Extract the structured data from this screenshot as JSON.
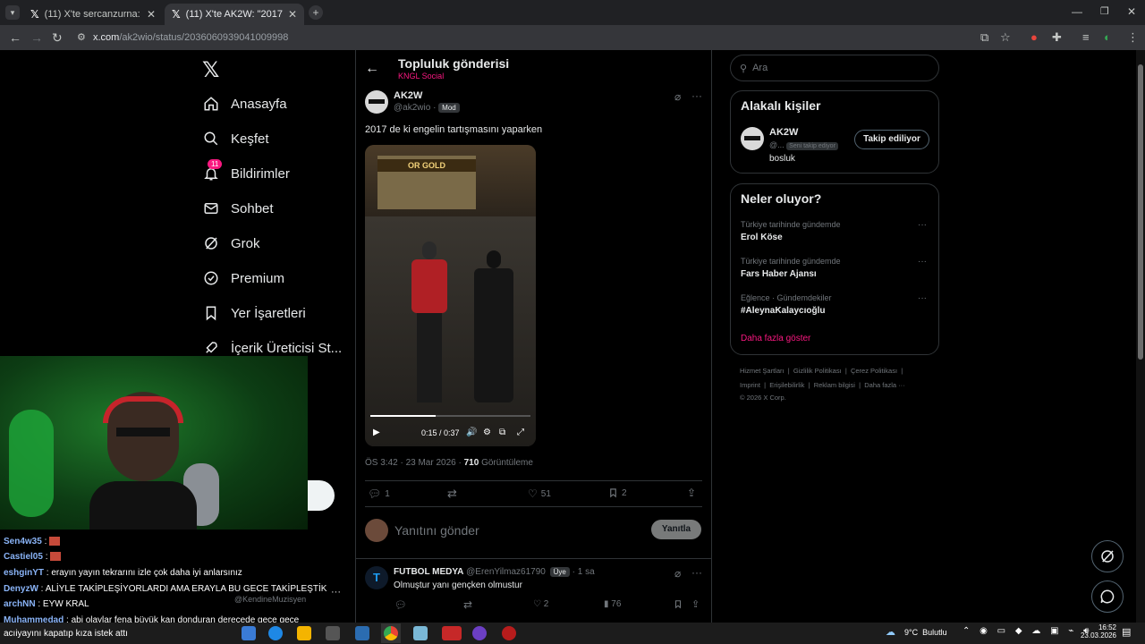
{
  "browser": {
    "tabs": [
      {
        "label": "(11) X'te sercanzurna: \"BEYLER L",
        "active": false
      },
      {
        "label": "(11) X'te AK2W: \"2017 de ki engel",
        "active": true
      }
    ],
    "url_host": "x.com",
    "url_path": "/ak2wio/status/2036060939041009998"
  },
  "nav": {
    "items": [
      {
        "label": "Anasayfa",
        "icon": "home-icon"
      },
      {
        "label": "Keşfet",
        "icon": "search-icon"
      },
      {
        "label": "Bildirimler",
        "icon": "bell-icon",
        "badge": "11"
      },
      {
        "label": "Sohbet",
        "icon": "mail-icon"
      },
      {
        "label": "Grok",
        "icon": "grok-icon"
      },
      {
        "label": "Premium",
        "icon": "verified-icon"
      },
      {
        "label": "Yer İşaretleri",
        "icon": "bookmark-icon"
      },
      {
        "label": "İçerik Üreticisi St...",
        "icon": "rocket-icon"
      }
    ]
  },
  "header": {
    "title": "Topluluk gönderisi",
    "subtitle": "KNGL Social"
  },
  "post": {
    "author_name": "AK2W",
    "handle": "@ak2wio",
    "role_badge": "Mod",
    "text": "2017 de ki engelin tartışmasını yaparken",
    "video_sign": "OR GOLD",
    "video_time": "0:15 / 0:37",
    "video_progress": 0.41,
    "timestamp": "ÖS 3:42 · 23 Mar 2026 · ",
    "views_count": "710",
    "views_label": " Görüntüleme",
    "replies": "1",
    "likes": "51",
    "bookmarks": "2"
  },
  "reply_box": {
    "placeholder": "Yanıtını gönder",
    "button": "Yanıtla"
  },
  "reply": {
    "name": "FUTBOL MEDYA",
    "handle": "@ErenYilmaz61790",
    "badge": "Üye",
    "time": "· 1 sa",
    "text": "Olmuştur yanı gençken olmustur",
    "likes": "2",
    "views": "76"
  },
  "search": {
    "placeholder": "Ara"
  },
  "related": {
    "title": "Alakalı kişiler",
    "name": "AK2W",
    "handle": "@...",
    "follows_you": "Seni takip ediyor",
    "follow_button": "Takip ediliyor",
    "bio": "bosluk"
  },
  "trends": {
    "title": "Neler oluyor?",
    "items": [
      {
        "category": "Türkiye tarihinde gündemde",
        "title": "Erol Köse"
      },
      {
        "category": "Türkiye tarihinde gündemde",
        "title": "Fars Haber Ajansı"
      },
      {
        "category": "Eğlence · Gündemdekiler",
        "title": "#AleynaKalaycıoğlu"
      }
    ],
    "more": "Daha fazla göster"
  },
  "footer": {
    "row1": [
      "Hizmet Şartları",
      "Gizlilik Politikası",
      "Çerez Politikası"
    ],
    "row2": [
      "Imprint",
      "Erişilebilirlik",
      "Reklam bilgisi",
      "Daha fazla ···"
    ],
    "copyright": "© 2026 X Corp."
  },
  "chat": [
    {
      "user": "Sen4w35",
      "msg": " : "
    },
    {
      "user": "Castiel05",
      "msg": " : "
    },
    {
      "user": "eshginYT",
      "msg": " : erayın yayın tekrarını izle çok daha iyi anlarsınız"
    },
    {
      "user": "DenyzW",
      "msg": " : ALİYLE TAKİPLEŞİYORLARDI AMA ERAYLA BU GECE TAKİPLEŞTİK"
    },
    {
      "user": "archNN",
      "msg": " : EYW KRAL"
    },
    {
      "user": "Muhammedad",
      "msg": " : abi olaylar fena büyük kan donduran derecede gece gece"
    },
    {
      "user": "",
      "msg": "acıiyayını kapatıp kıza istek attı"
    }
  ],
  "overlay_handle": "@KendineMuzisyen",
  "taskbar": {
    "weather": "9°C  Bulutlu",
    "time": "16:52",
    "date": "23.03.2026"
  },
  "colors": {
    "accent": "#1d9bf0",
    "pink": "#f91880",
    "bg": "#000000"
  }
}
